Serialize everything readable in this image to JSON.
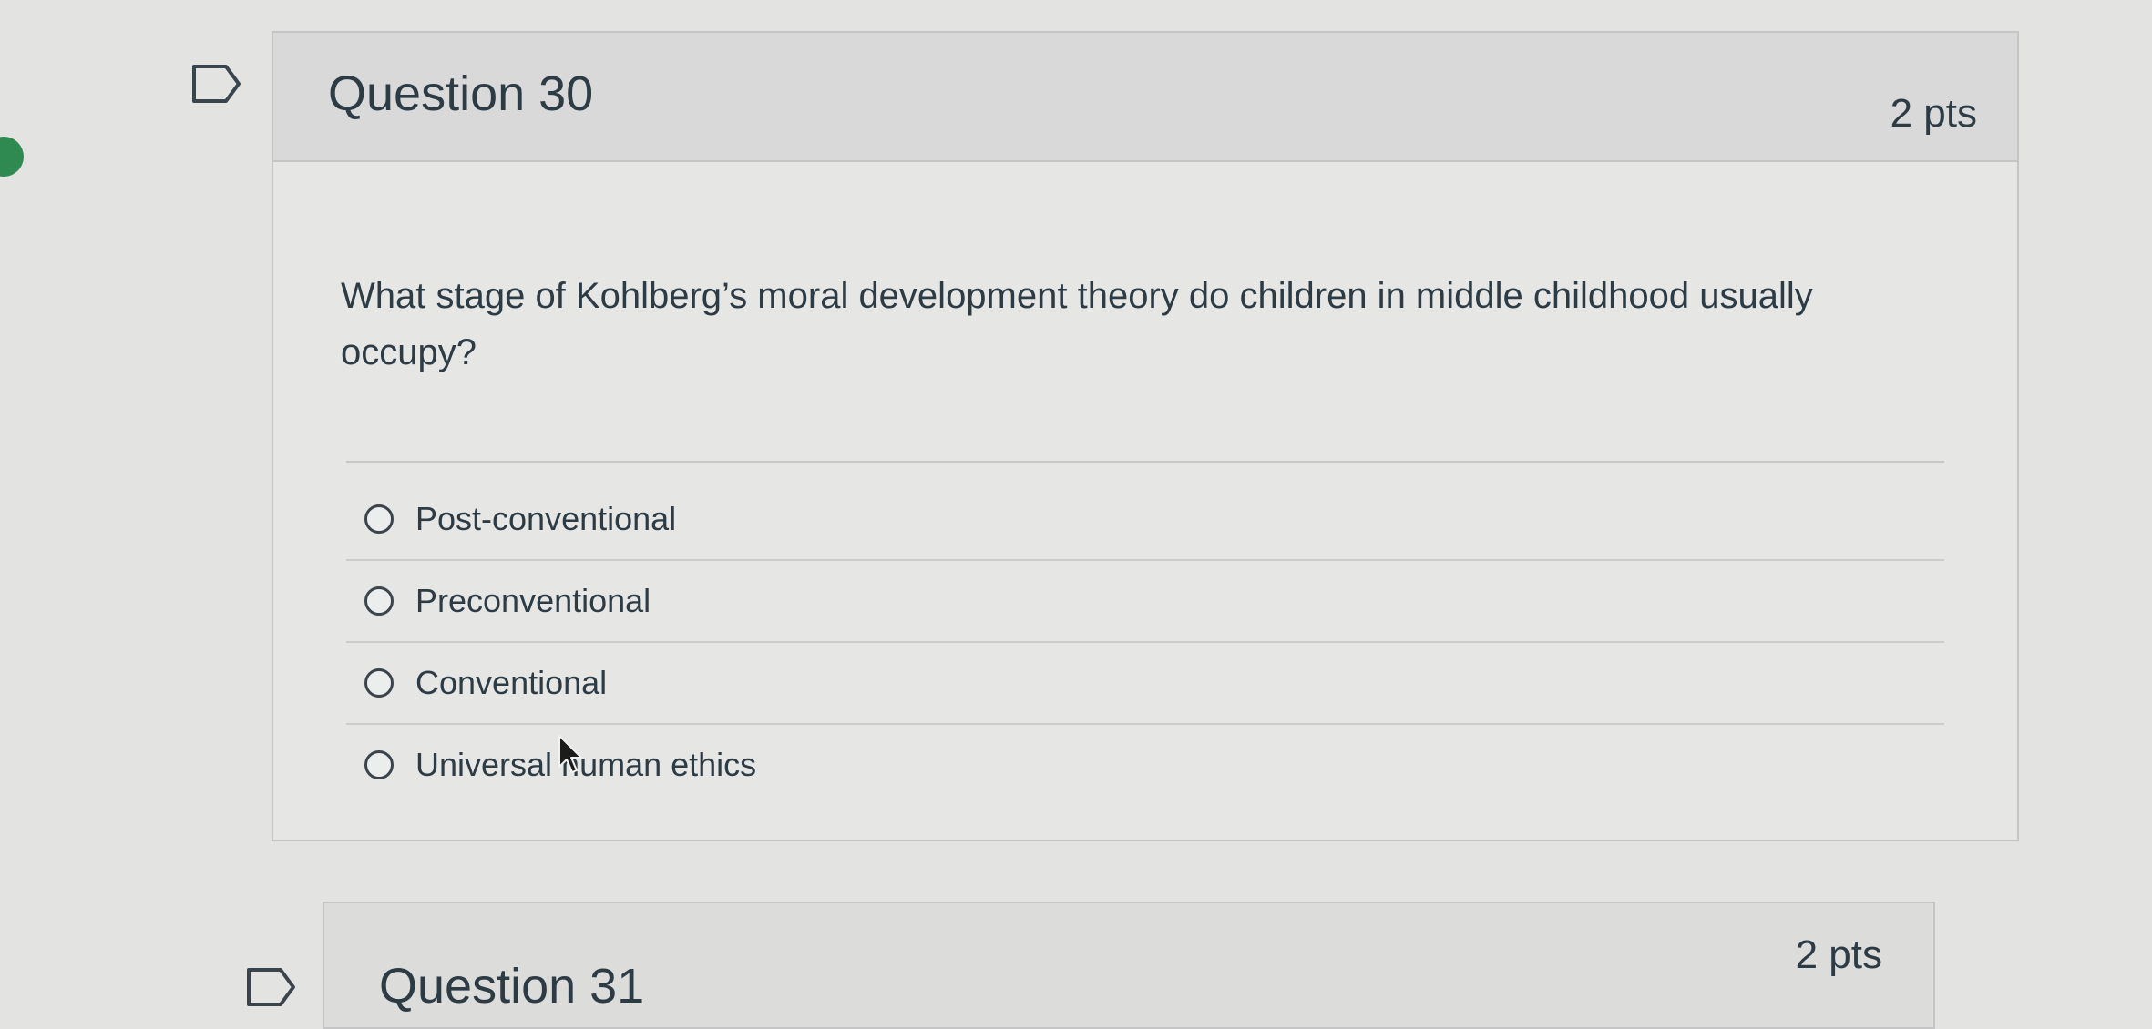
{
  "question30": {
    "title": "Question 30",
    "points": "2 pts",
    "text": "What stage of Kohlberg’s moral development theory do children in middle childhood usually occupy?",
    "answers": [
      {
        "label": "Post-conventional",
        "selected": false
      },
      {
        "label": "Preconventional",
        "selected": false
      },
      {
        "label": "Conventional",
        "selected": false
      },
      {
        "label": "Universal human ethics",
        "selected": false
      }
    ]
  },
  "question31": {
    "title": "Question 31",
    "points": "2 pts"
  },
  "colors": {
    "background": "#e3e3e1",
    "header": "#d8d9d8",
    "text": "#2d3b45",
    "side_indicator": "#2f8a52"
  },
  "icons": {
    "flag": "bookmark-flag-icon",
    "radio": "radio-button-icon",
    "cursor": "mouse-pointer-icon"
  }
}
